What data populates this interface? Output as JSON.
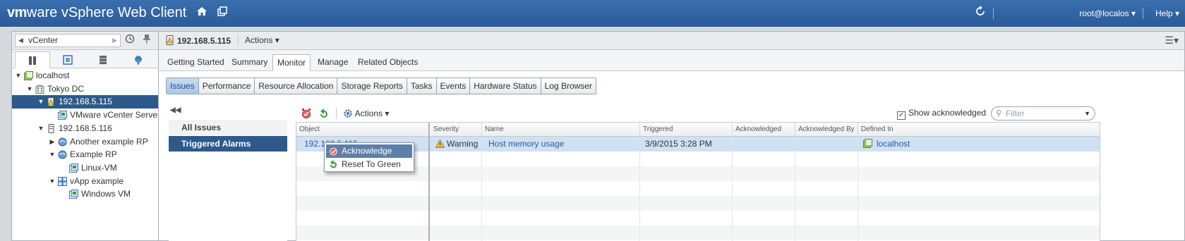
{
  "header": {
    "brand_vm": "vm",
    "brand_ware": "ware",
    "app_title": "vSphere Web Client",
    "user": "root@localos",
    "help": "Help"
  },
  "navigator": {
    "breadcrumb": "vCenter",
    "tree": [
      {
        "label": "localhost",
        "level": 0,
        "toggle": "expanded",
        "icon": "vcenter-icon"
      },
      {
        "label": "Tokyo DC",
        "level": 1,
        "toggle": "expanded",
        "icon": "datacenter-icon"
      },
      {
        "label": "192.168.5.115",
        "level": 2,
        "toggle": "expanded",
        "icon": "host-warning-icon",
        "selected": true
      },
      {
        "label": "VMware vCenter Server ...",
        "level": 3,
        "toggle": "none",
        "icon": "vm-icon"
      },
      {
        "label": "192.168.5.116",
        "level": 2,
        "toggle": "expanded",
        "icon": "host-icon"
      },
      {
        "label": "Another example RP",
        "level": 3,
        "toggle": "collapsed",
        "icon": "resource-pool-icon"
      },
      {
        "label": "Example RP",
        "level": 3,
        "toggle": "expanded",
        "icon": "resource-pool-icon"
      },
      {
        "label": "Linux-VM",
        "level": 4,
        "toggle": "none",
        "icon": "vm-icon"
      },
      {
        "label": "vApp example",
        "level": 3,
        "toggle": "expanded",
        "icon": "vapp-icon"
      },
      {
        "label": "Windows VM",
        "level": 4,
        "toggle": "none",
        "icon": "vm-icon"
      }
    ]
  },
  "main": {
    "object_title": "192.168.5.115",
    "actions_label": "Actions",
    "tabs": [
      {
        "label": "Getting Started"
      },
      {
        "label": "Summary"
      },
      {
        "label": "Monitor",
        "active": true
      },
      {
        "label": "Manage"
      },
      {
        "label": "Related Objects"
      }
    ],
    "subtabs": [
      {
        "label": "Issues",
        "active": true
      },
      {
        "label": "Performance"
      },
      {
        "label": "Resource Allocation"
      },
      {
        "label": "Storage Reports"
      },
      {
        "label": "Tasks"
      },
      {
        "label": "Events"
      },
      {
        "label": "Hardware Status"
      },
      {
        "label": "Log Browser"
      }
    ],
    "issues_nav": {
      "all_issues": "All Issues",
      "triggered_alarms": "Triggered Alarms"
    },
    "toolbar": {
      "actions_label": "Actions",
      "show_acknowledged": "Show acknowledged",
      "show_acknowledged_checked": true,
      "filter_placeholder": "Filter"
    },
    "grid": {
      "columns": [
        "Object",
        "Severity",
        "Name",
        "Triggered",
        "Acknowledged",
        "Acknowledged By",
        "Defined In"
      ],
      "rows": [
        {
          "object": "192.168.5.115",
          "severity": "Warning",
          "name": "Host memory usage",
          "triggered": "3/9/2015 3:28 PM",
          "acknowledged": "",
          "acknowledged_by": "",
          "defined_in": "localhost"
        }
      ]
    },
    "context_menu": {
      "acknowledge": "Acknowledge",
      "reset_to_green": "Reset To Green"
    }
  },
  "colors": {
    "header_blue": "#2f639f",
    "selection_blue": "#2d5a8a",
    "row_selected": "#cfe1f3",
    "link": "#2b5d9a"
  }
}
